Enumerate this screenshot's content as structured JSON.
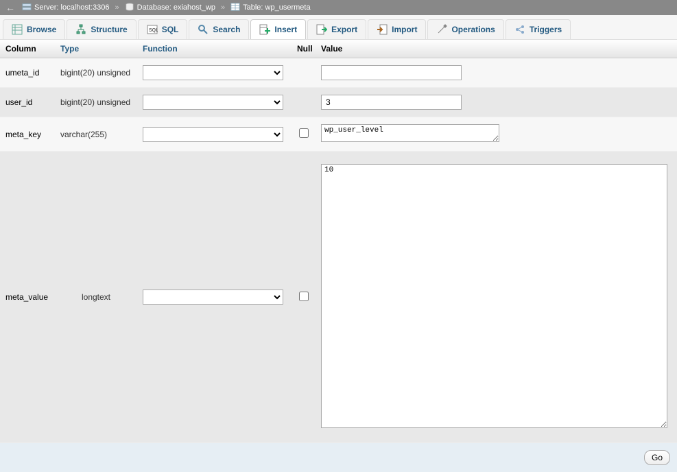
{
  "breadcrumb": {
    "server_label": "Server:",
    "server_value": "localhost:3306",
    "db_label": "Database:",
    "db_value": "exiahost_wp",
    "table_label": "Table:",
    "table_value": "wp_usermeta"
  },
  "tabs": {
    "browse": "Browse",
    "structure": "Structure",
    "sql": "SQL",
    "search": "Search",
    "insert": "Insert",
    "export": "Export",
    "import": "Import",
    "operations": "Operations",
    "triggers": "Triggers"
  },
  "headers": {
    "column": "Column",
    "type": "Type",
    "function": "Function",
    "null": "Null",
    "value": "Value"
  },
  "rows": {
    "r0": {
      "column": "umeta_id",
      "type": "bigint(20) unsigned",
      "value": ""
    },
    "r1": {
      "column": "user_id",
      "type": "bigint(20) unsigned",
      "value": "3"
    },
    "r2": {
      "column": "meta_key",
      "type": "varchar(255)",
      "value": "wp_user_level"
    },
    "r3": {
      "column": "meta_value",
      "type": "longtext",
      "value": "10"
    }
  },
  "footer": {
    "go": "Go"
  }
}
